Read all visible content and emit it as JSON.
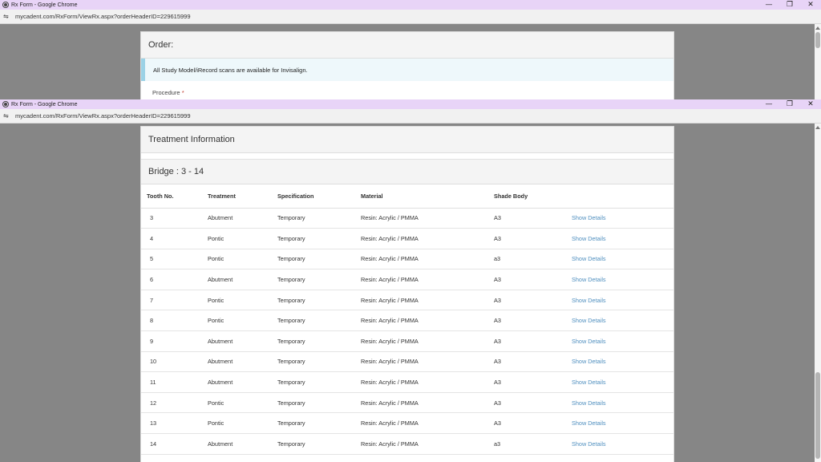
{
  "browser": {
    "window_title": "Rx Form - Google Chrome",
    "url": "mycadent.com/RxForm/ViewRx.aspx?orderHeaderID=229615999",
    "controls": {
      "minimize": "—",
      "restore": "❐",
      "close": "✕"
    }
  },
  "order_section": {
    "title": "Order:",
    "info": "All Study Model/iRecord scans are available for Invisalign.",
    "procedure_label": "Procedure",
    "required_mark": "*"
  },
  "treatment_section": {
    "title": "Treatment Information",
    "bridge_title": "Bridge : 3 - 14",
    "columns": [
      "Tooth No.",
      "Treatment",
      "Specification",
      "Material",
      "Shade Body",
      ""
    ],
    "rows": [
      {
        "tooth": "3",
        "treatment": "Abutment",
        "specification": "Temporary",
        "material": "Resin: Acrylic / PMMA",
        "shade": "A3",
        "action": "Show Details"
      },
      {
        "tooth": "4",
        "treatment": "Pontic",
        "specification": "Temporary",
        "material": "Resin: Acrylic / PMMA",
        "shade": "A3",
        "action": "Show Details"
      },
      {
        "tooth": "5",
        "treatment": "Pontic",
        "specification": "Temporary",
        "material": "Resin: Acrylic / PMMA",
        "shade": "a3",
        "action": "Show Details"
      },
      {
        "tooth": "6",
        "treatment": "Abutment",
        "specification": "Temporary",
        "material": "Resin: Acrylic / PMMA",
        "shade": "A3",
        "action": "Show Details"
      },
      {
        "tooth": "7",
        "treatment": "Pontic",
        "specification": "Temporary",
        "material": "Resin: Acrylic / PMMA",
        "shade": "A3",
        "action": "Show Details"
      },
      {
        "tooth": "8",
        "treatment": "Pontic",
        "specification": "Temporary",
        "material": "Resin: Acrylic / PMMA",
        "shade": "A3",
        "action": "Show Details"
      },
      {
        "tooth": "9",
        "treatment": "Abutment",
        "specification": "Temporary",
        "material": "Resin: Acrylic / PMMA",
        "shade": "A3",
        "action": "Show Details"
      },
      {
        "tooth": "10",
        "treatment": "Abutment",
        "specification": "Temporary",
        "material": "Resin: Acrylic / PMMA",
        "shade": "A3",
        "action": "Show Details"
      },
      {
        "tooth": "11",
        "treatment": "Abutment",
        "specification": "Temporary",
        "material": "Resin: Acrylic / PMMA",
        "shade": "A3",
        "action": "Show Details"
      },
      {
        "tooth": "12",
        "treatment": "Pontic",
        "specification": "Temporary",
        "material": "Resin: Acrylic / PMMA",
        "shade": "A3",
        "action": "Show Details"
      },
      {
        "tooth": "13",
        "treatment": "Pontic",
        "specification": "Temporary",
        "material": "Resin: Acrylic / PMMA",
        "shade": "A3",
        "action": "Show Details"
      },
      {
        "tooth": "14",
        "treatment": "Abutment",
        "specification": "Temporary",
        "material": "Resin: Acrylic / PMMA",
        "shade": "a3",
        "action": "Show Details"
      }
    ]
  },
  "colors": {
    "titlebar": "#e8d4f7",
    "link": "#4f8fbf",
    "banner_accent": "#9bd2e6",
    "required": "#c0392b"
  },
  "icons": {
    "favicon": "chrome-page-icon",
    "site_info": "tune-icon"
  }
}
